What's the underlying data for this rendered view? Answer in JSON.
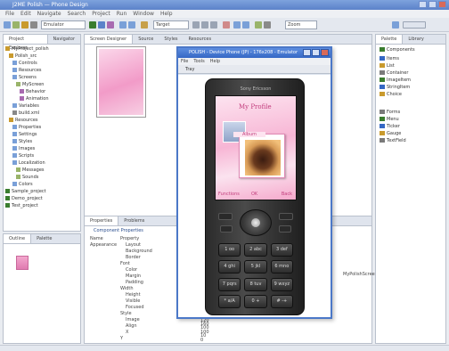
{
  "ide": {
    "title": "J2ME Polish — Phone Design",
    "menu": [
      "File",
      "Edit",
      "Navigate",
      "Search",
      "Project",
      "Run",
      "Window",
      "Help"
    ],
    "toolbar_combo": "Emulator",
    "toolbar_combo2": "Target",
    "toolbar_combo3": "Zoom"
  },
  "project": {
    "tabs": [
      "Project Explorer",
      "Navigator"
    ],
    "tree": [
      "MyProject_polish",
      "Polish_src",
      "Controls",
      "Resources",
      "Screens",
      "MyScreen",
      "Behavior",
      "Animation",
      "Variables",
      "build.xml",
      "Resources",
      "Properties",
      "Settings",
      "Styles",
      "Images",
      "Scripts",
      "Localization",
      "Messages",
      "Sounds",
      "Colors",
      "Sample_project",
      "Demo_project",
      "Test_project"
    ]
  },
  "thumbpane": {
    "tabs": [
      "Outline",
      "Palette"
    ]
  },
  "editor": {
    "tabs": [
      "Screen Designer",
      "Source",
      "Styles",
      "Resources"
    ]
  },
  "props": {
    "tabs": [
      "Properties",
      "Problems"
    ],
    "header": "Component Properties",
    "left": [
      "Name",
      "Appearance"
    ],
    "right": [
      "Property",
      "Layout",
      "Background",
      "Border",
      "Font",
      "Color",
      "Margin",
      "Padding",
      "Width",
      "Height",
      "Visible",
      "Focused",
      "Style",
      "Image",
      "Align",
      "X",
      "Y"
    ],
    "values": [
      "true",
      "false",
      "0",
      "0",
      "120",
      "160",
      "100",
      "100",
      "10",
      "0"
    ],
    "right_note": "MyPolishScreen"
  },
  "palette": {
    "tabs": [
      "Palette",
      "Library"
    ],
    "items": [
      "Components",
      "Items",
      "List",
      "Container",
      "ImageItem",
      "StringItem",
      "Choice",
      "Forms",
      "Menu",
      "Ticker",
      "Gauge",
      "TextField"
    ],
    "colors": [
      "#3a7d2e",
      "#3467c4",
      "#c99a2d",
      "#7a7a7a"
    ]
  },
  "emulator": {
    "title": "POLISH - Device Phone (JP) - 176x208 - Emulator",
    "menu": [
      "File",
      "Tools",
      "Help"
    ],
    "toolbar_label": "Tray",
    "brand": "Sony Ericsson",
    "screen": {
      "title": "My Profile",
      "card_label": "Album",
      "soft_left": "Functions",
      "soft_mid": "OK",
      "soft_right": "Back"
    },
    "keys": [
      "1 oo",
      "2 abc",
      "3 def",
      "4 ghi",
      "5 jkl",
      "6 mno",
      "7 pqrs",
      "8 tuv",
      "9 wxyz",
      "* a/A",
      "0 +",
      "# -+"
    ]
  },
  "colors": {
    "accent": "#3467c4",
    "lcd_pink": "#f29bc8",
    "lcd_text": "#c23d7c"
  }
}
